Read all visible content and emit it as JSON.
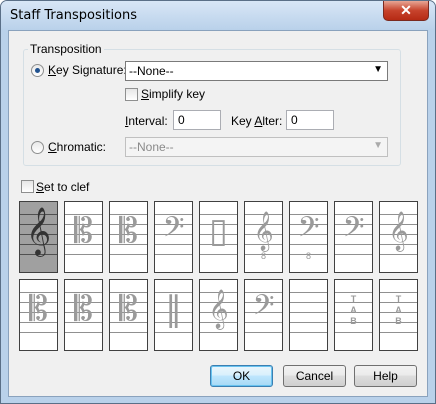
{
  "window": {
    "title": "Staff Transpositions",
    "close_glyph": "✕"
  },
  "transposition": {
    "group_label": "Transposition",
    "key_signature": {
      "label_prefix": "",
      "mnemonic": "K",
      "label_rest": "ey Signature:",
      "selected": true,
      "value": "--None--",
      "simplify_key": {
        "mnemonic": "S",
        "label_rest": "implify key",
        "checked": false
      },
      "interval": {
        "mnemonic": "I",
        "label_rest": "nterval:",
        "value": "0"
      },
      "key_alter": {
        "label_prefix": "Key ",
        "mnemonic": "A",
        "label_rest": "lter:",
        "value": "0"
      }
    },
    "chromatic": {
      "mnemonic": "C",
      "label_rest": "hromatic:",
      "selected": false,
      "value": "--None--"
    }
  },
  "set_to_clef": {
    "mnemonic": "S",
    "label_rest": "et to clef",
    "checked": false
  },
  "clefs": [
    {
      "name": "treble",
      "glyph": "𝄞",
      "sub": ""
    },
    {
      "name": "alto",
      "glyph": "𝄡",
      "sub": ""
    },
    {
      "name": "tenor",
      "glyph": "𝄡",
      "sub": ""
    },
    {
      "name": "bass",
      "glyph": "𝄢",
      "sub": ""
    },
    {
      "name": "percussion",
      "glyph": "▯",
      "sub": ""
    },
    {
      "name": "treble-8vb",
      "glyph": "𝄞",
      "sub": "8"
    },
    {
      "name": "bass-8vb",
      "glyph": "𝄢",
      "sub": "8"
    },
    {
      "name": "baritone-f",
      "glyph": "𝄢",
      "sub": ""
    },
    {
      "name": "treble-8vb-alt",
      "glyph": "𝄞",
      "sub": ""
    },
    {
      "name": "mezzo-soprano",
      "glyph": "𝄡",
      "sub": ""
    },
    {
      "name": "baritone-c",
      "glyph": "𝄡",
      "sub": ""
    },
    {
      "name": "tenor-low",
      "glyph": "𝄡",
      "sub": ""
    },
    {
      "name": "percussion-2",
      "glyph": "‖",
      "sub": ""
    },
    {
      "name": "treble-alt",
      "glyph": "𝄞",
      "sub": ""
    },
    {
      "name": "bass-8va",
      "glyph": "𝄢",
      "sub": ""
    },
    {
      "name": "blank",
      "glyph": "",
      "sub": ""
    },
    {
      "name": "tab",
      "glyph": "",
      "sub": "",
      "tab": "T\nA\nB"
    },
    {
      "name": "tab-small",
      "glyph": "",
      "sub": "",
      "tab": "T\nA\nB"
    }
  ],
  "selected_clef": 0,
  "buttons": {
    "ok": "OK",
    "cancel": "Cancel",
    "help": "Help"
  }
}
